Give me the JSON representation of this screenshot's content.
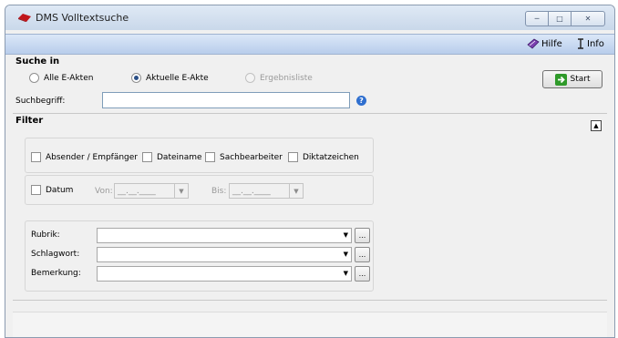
{
  "window": {
    "title": "DMS Volltextsuche"
  },
  "toolbar": {
    "help_label": "Hilfe",
    "info_label": "Info"
  },
  "search_in": {
    "title": "Suche in",
    "options": [
      "Alle E-Akten",
      "Aktuelle E-Akte",
      "Ergebnisliste"
    ],
    "selected": "Aktuelle E-Akte",
    "search_term_label": "Suchbegriff:",
    "search_term_value": "",
    "start_label": "Start"
  },
  "filter": {
    "title": "Filter",
    "checkboxes": [
      "Absender / Empfänger",
      "Dateiname",
      "Sachbearbeiter",
      "Diktatzeichen"
    ],
    "date_label": "Datum",
    "from_label": "Von:",
    "to_label": "Bis:",
    "date_placeholder": "__.__.____",
    "rubrik_label": "Rubrik:",
    "schlagwort_label": "Schlagwort:",
    "bemerkung_label": "Bemerkung:",
    "browse_label": "..."
  }
}
